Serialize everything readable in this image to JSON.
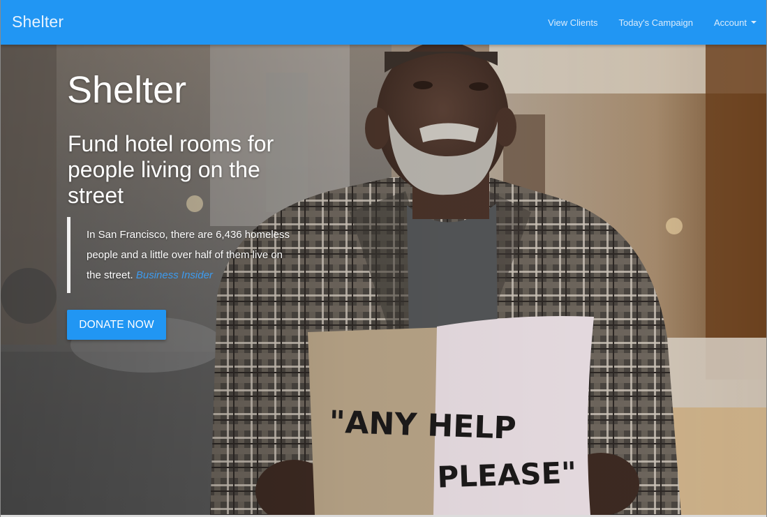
{
  "navbar": {
    "brand": "Shelter",
    "links": [
      {
        "label": "View Clients"
      },
      {
        "label": "Today's Campaign"
      },
      {
        "label": "Account",
        "has_dropdown": true,
        "icon": "caret-down-icon"
      }
    ],
    "background_color": "#2196f3"
  },
  "hero": {
    "title": "Shelter",
    "subtitle": "Fund hotel rooms for people living on the street",
    "quote": {
      "text": "In San Francisco, there are 6,436 homeless people and a little over half of them live on the street.",
      "source": "Business Insider"
    },
    "cta_label": "DONATE NOW",
    "image": {
      "subject": "man holding cardboard sign and pillow",
      "sign_line_1": "\"ANY HELP",
      "sign_line_2": "PLEASE\""
    }
  },
  "colors": {
    "accent": "#2196f3",
    "link": "#3d9bef"
  }
}
